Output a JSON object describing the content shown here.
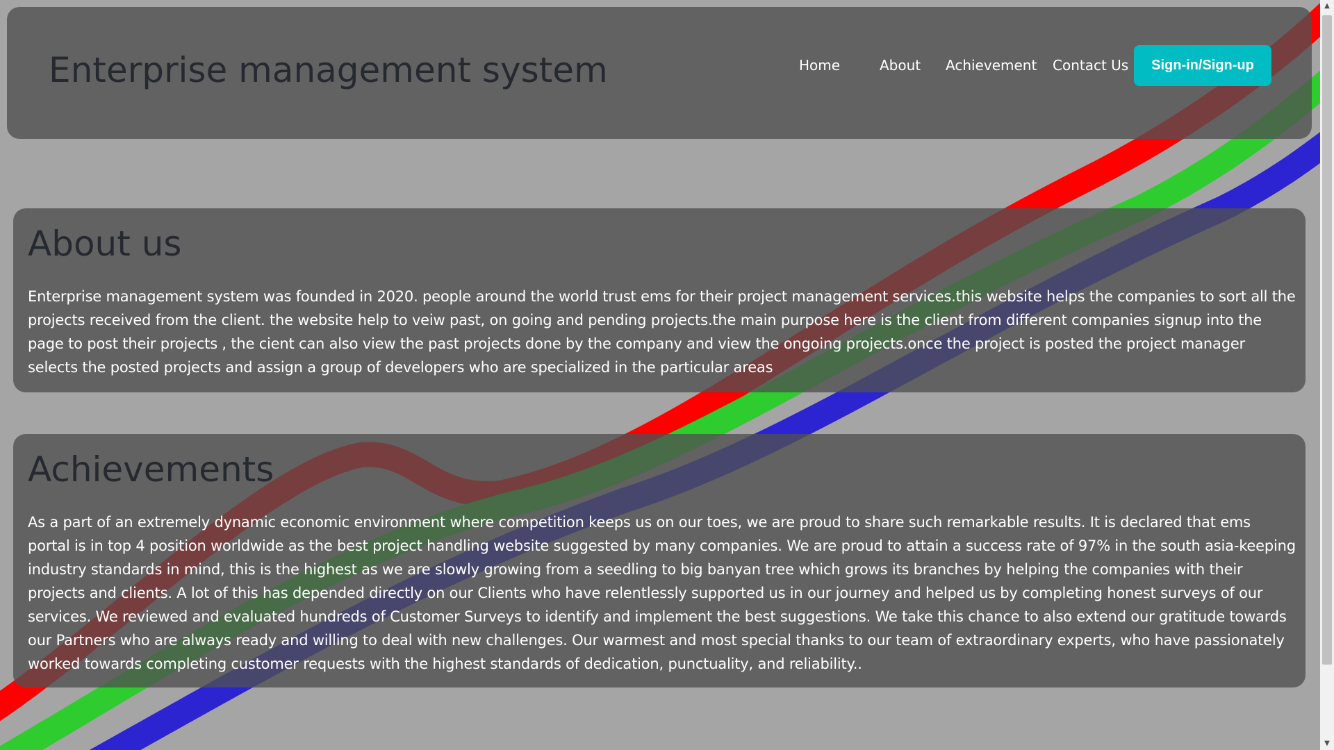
{
  "header": {
    "title": "Enterprise management system",
    "nav": {
      "home": "Home",
      "about": "About",
      "achievement": "Achievement",
      "contact": "Contact Us"
    },
    "signin_label": "Sign-in/Sign-up"
  },
  "about": {
    "heading": "About us",
    "text": "Enterprise management system was founded in 2020. people around the world trust ems for their project management services.this website helps the companies to sort all the projects received from the client. the website help to veiw past, on going and pending projects.the main purpose here is the client from different companies signup into the page to post their projects , the cient can also view the past projects done by the company and view the ongoing projects.once the project is posted the project manager selects the posted projects and assign a group of developers who are specialized in the particular areas"
  },
  "achievements": {
    "heading": "Achievements",
    "text": "As a part of an extremely dynamic economic environment where competition keeps us on our toes, we are proud to share such remarkable results. It is declared that ems portal is in top 4 position worldwide as the best project handling website suggested by many companies. We are proud to attain a success rate of 97% in the south asia-keeping industry standards in mind, this is the highest as we are slowly growing from a seedling to big banyan tree which grows its branches by helping the companies with their projects and clients. A lot of this has depended directly on our Clients who have relentlessly supported us in our journey and helped us by completing honest surveys of our services. We reviewed and evaluated hundreds of Customer Surveys to identify and implement the best suggestions. We take this chance to also extend our gratitude towards our Partners who are always ready and willing to deal with new challenges. Our warmest and most special thanks to our team of extraordinary experts, who have passionately worked towards completing customer requests with the highest standards of dedication, punctuality, and reliability.."
  },
  "colors": {
    "page_background": "#a5a5a5",
    "panel_background": "#505050",
    "heading_text": "#262a30",
    "accent_button": "#01bcc2",
    "stripe_red": "#ff0000",
    "stripe_green": "#2ecc2e",
    "stripe_blue": "#2b24d0"
  },
  "icons": {
    "scroll_up": "triangle-up",
    "scroll_down": "triangle-down"
  }
}
